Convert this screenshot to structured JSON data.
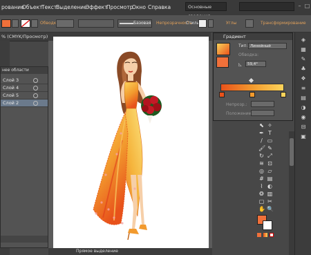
{
  "menubar": {
    "items": [
      "рование",
      "Объект",
      "Текст",
      "Выделение",
      "Эффект",
      "Просмотр",
      "Окно",
      "Справка"
    ],
    "workspace": "Основные сведения"
  },
  "controlbar": {
    "stroke_label": "Обводка",
    "stroke_style": "Базовая",
    "opacity_label": "Непрозрачность",
    "style_label": "Стиль:",
    "align_label": "Углы",
    "transform_label": "Трансформирование"
  },
  "document": {
    "tab_title": "% (CMYK/Просмотр)"
  },
  "layers": {
    "title": "нее области",
    "rows": [
      "Слой 3",
      "Слой 4",
      "Слой 5",
      "Слой 2"
    ]
  },
  "status": {
    "tool": "Прямое выделение"
  },
  "gradient": {
    "title": "Градиент",
    "type_label": "Тип:",
    "type_value": "Линейный",
    "stroke_label": "Обводка:",
    "angle_value": "59,4°",
    "opacity_label": "Непрозр.:",
    "position_label": "Положение:",
    "stops": [
      "#e8521b",
      "#f29a2e",
      "#fcd35a"
    ]
  },
  "colors": {
    "accent": "#e0a05a",
    "fill": "#f0703a",
    "selected_layer": "#6b7a8c"
  },
  "tools": [
    "selection-icon",
    "direct-selection-icon",
    "magic-wand-icon",
    "lasso-icon",
    "pen-icon",
    "type-icon",
    "line-icon",
    "rectangle-icon",
    "brush-icon",
    "pencil-icon",
    "blob-brush-icon",
    "eraser-icon",
    "rotate-icon",
    "scale-icon",
    "width-icon",
    "warp-icon",
    "free-transform-icon",
    "shape-builder-icon",
    "perspective-icon",
    "mesh-icon",
    "gradient-icon",
    "eyedropper-icon",
    "blend-icon",
    "symbol-sprayer-icon",
    "graph-icon",
    "artboard-icon",
    "slice-icon",
    "hand-icon",
    "zoom-icon"
  ]
}
